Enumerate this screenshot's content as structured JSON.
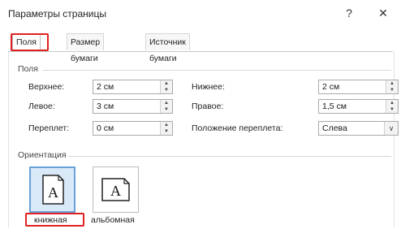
{
  "window": {
    "title": "Параметры страницы",
    "help_label": "?",
    "close_label": "✕"
  },
  "tabs": [
    {
      "label": "Поля"
    },
    {
      "label": "Размер бумаги"
    },
    {
      "label": "Источник бумаги"
    }
  ],
  "margins": {
    "group_label": "Поля",
    "top": {
      "label": "Верхнее:",
      "value": "2 см"
    },
    "bottom": {
      "label": "Нижнее:",
      "value": "2 см"
    },
    "left": {
      "label": "Левое:",
      "value": "3 см"
    },
    "right": {
      "label": "Правое:",
      "value": "1,5 см"
    },
    "gutter": {
      "label": "Переплет:",
      "value": "0 см"
    },
    "gutter_position": {
      "label": "Положение переплета:",
      "value": "Слева"
    }
  },
  "orientation": {
    "group_label": "Ориентация",
    "portrait": {
      "label": "книжная",
      "glyph": "A",
      "selected": true
    },
    "landscape": {
      "label": "альбомная",
      "glyph": "A",
      "selected": false
    }
  },
  "highlight_color": "#e02020"
}
